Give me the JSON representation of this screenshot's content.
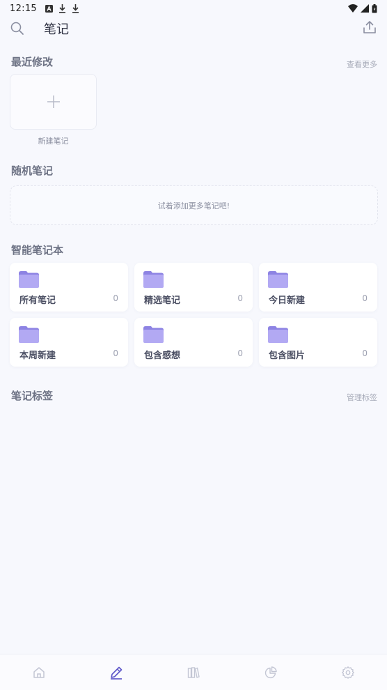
{
  "status_bar": {
    "time": "12:15",
    "left_icons": [
      "A",
      "⤓",
      "⤓"
    ]
  },
  "header": {
    "title": "笔记"
  },
  "recent": {
    "title": "最近修改",
    "more_link": "查看更多",
    "new_note_label": "新建笔记"
  },
  "random": {
    "title": "随机笔记",
    "empty_hint": "试着添加更多笔记吧!"
  },
  "smart_notebooks": {
    "title": "智能笔记本",
    "items": [
      {
        "name": "所有笔记",
        "count": "0"
      },
      {
        "name": "精选笔记",
        "count": "0"
      },
      {
        "name": "今日新建",
        "count": "0"
      },
      {
        "name": "本周新建",
        "count": "0"
      },
      {
        "name": "包含感想",
        "count": "0"
      },
      {
        "name": "包含图片",
        "count": "0"
      }
    ]
  },
  "tags": {
    "title": "笔记标签",
    "manage_link": "管理标签"
  },
  "colors": {
    "background": "#f7f8fd",
    "folder_front": "#b2a9f3",
    "folder_back": "#8d83e3",
    "nav_active": "#5e57c9",
    "nav_inactive": "#c3c6d4"
  },
  "bottom_nav": [
    "home-icon",
    "pencil-icon",
    "books-icon",
    "pie-chart-icon",
    "gear-icon"
  ]
}
